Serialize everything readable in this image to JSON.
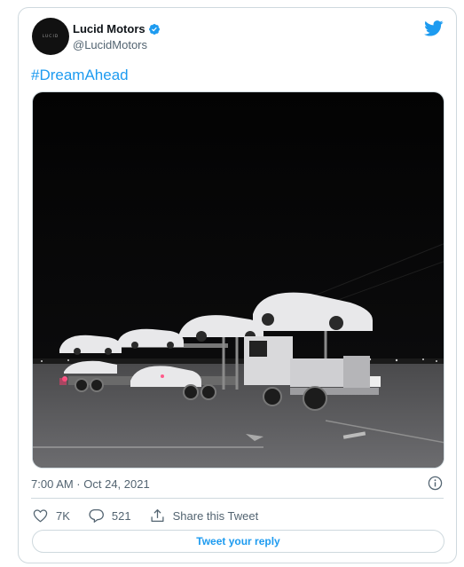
{
  "author": {
    "name": "Lucid Motors",
    "handle": "@LucidMotors",
    "avatar_logo": "LUCID"
  },
  "tweet": {
    "text": "#DreamAhead",
    "timestamp": "7:00 AM · Oct 24, 2021"
  },
  "actions": {
    "likes": "7K",
    "replies": "521",
    "share_label": "Share this Tweet"
  },
  "reply_button_label": "Tweet your reply",
  "colors": {
    "accent": "#1d9bf0",
    "secondary_text": "#536471",
    "border": "#cfd9de"
  },
  "icons": [
    "verified-badge-icon",
    "twitter-bird-icon",
    "info-icon",
    "heart-icon",
    "reply-bubble-icon",
    "share-icon"
  ]
}
